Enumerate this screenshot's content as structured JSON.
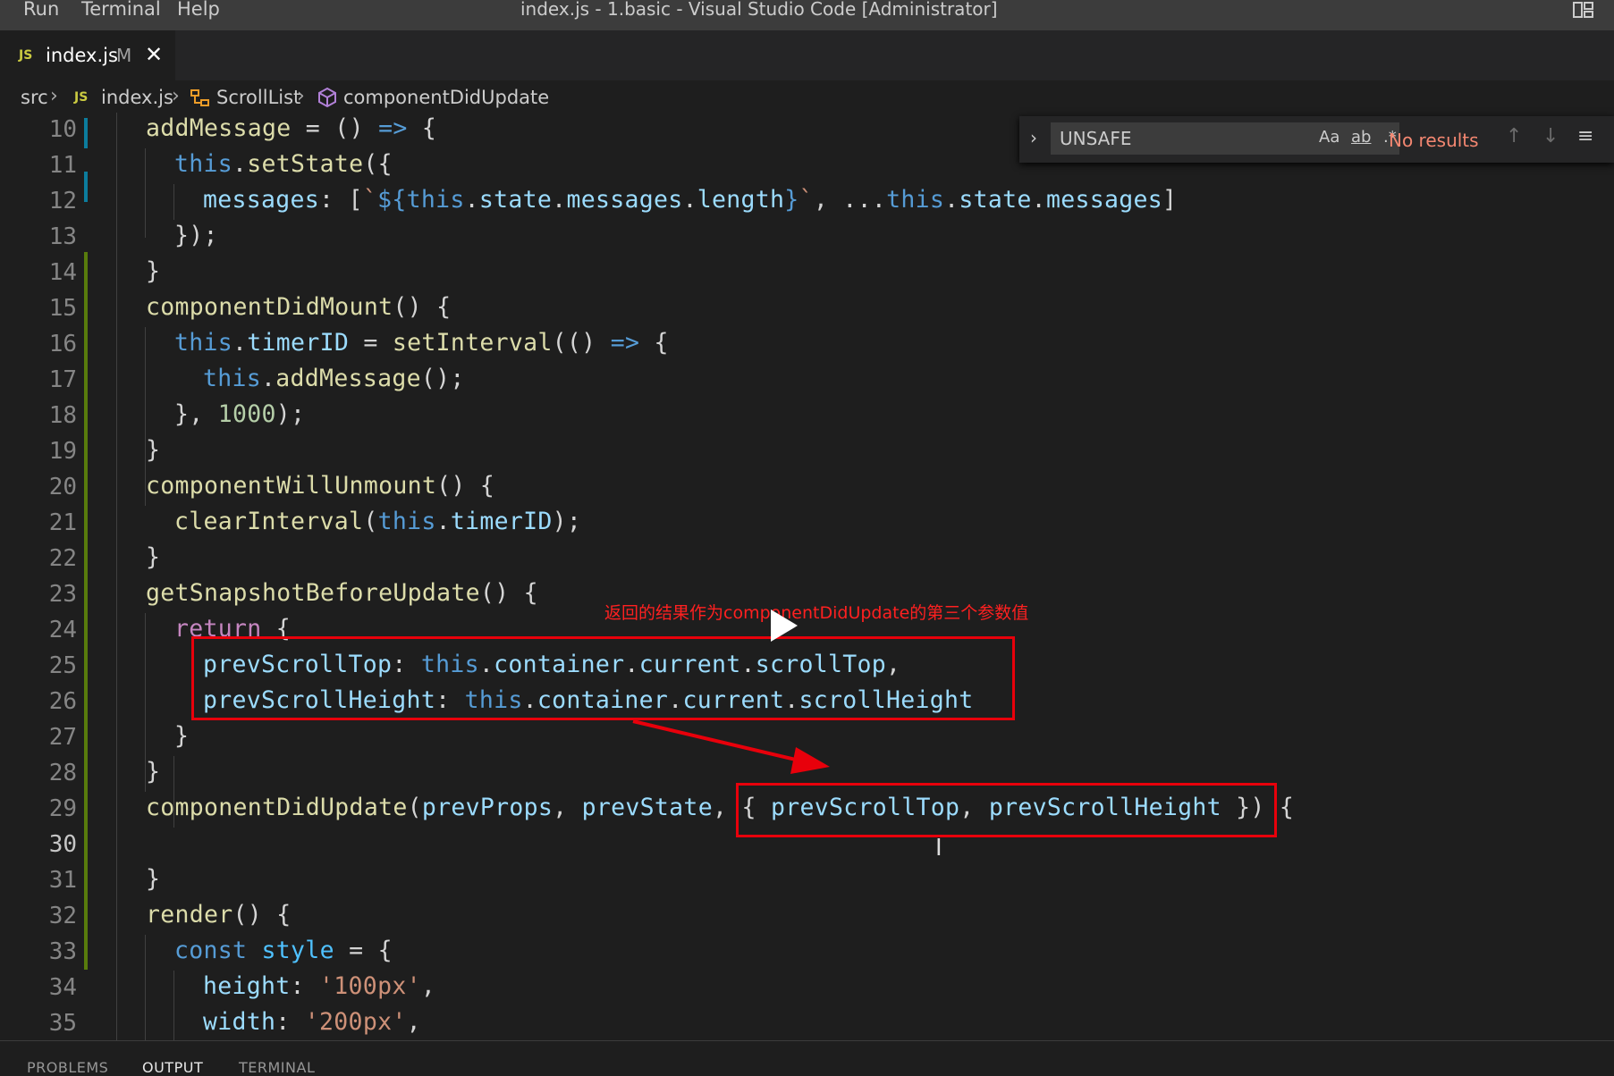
{
  "titlebar": {
    "menu": [
      "Run",
      "Terminal",
      "Help"
    ],
    "title": "index.js - 1.basic - Visual Studio Code [Administrator]"
  },
  "tab": {
    "icon": "JS",
    "name": "index.js",
    "modified": "M",
    "close": "✕"
  },
  "breadcrumb": {
    "folder": "src",
    "file_icon": "JS",
    "file": "index.js",
    "class": "ScrollList",
    "method": "componentDidUpdate"
  },
  "gutter": [
    "10",
    "11",
    "12",
    "13",
    "14",
    "15",
    "16",
    "17",
    "18",
    "19",
    "20",
    "21",
    "22",
    "23",
    "24",
    "25",
    "26",
    "27",
    "28",
    "29",
    "30",
    "31",
    "32",
    "33",
    "34",
    "35"
  ],
  "active_line": "30",
  "code": {
    "l10": [
      "addMessage",
      " = () ",
      "=>",
      " {"
    ],
    "l11": [
      "this",
      ".",
      "setState",
      "({"
    ],
    "l12": [
      "messages",
      ": [",
      "`",
      "${",
      "this",
      ".",
      "state",
      ".",
      "messages",
      ".",
      "length",
      "}",
      "`",
      ", ...",
      "this",
      ".",
      "state",
      ".",
      "messages",
      "]"
    ],
    "l13": [
      "});"
    ],
    "l14": [
      "}"
    ],
    "l15": [
      "componentDidMount",
      "() {"
    ],
    "l16": [
      "this",
      ".",
      "timerID",
      " = ",
      "setInterval",
      "(() ",
      "=>",
      " {"
    ],
    "l17": [
      "this",
      ".",
      "addMessage",
      "();"
    ],
    "l18": [
      "}, ",
      "1000",
      ");"
    ],
    "l19": [
      "}"
    ],
    "l20": [
      "componentWillUnmount",
      "() {"
    ],
    "l21": [
      "clearInterval",
      "(",
      "this",
      ".",
      "timerID",
      ");"
    ],
    "l22": [
      "}"
    ],
    "l23": [
      "getSnapshotBeforeUpdate",
      "() {"
    ],
    "l24": [
      "return",
      " {"
    ],
    "l25": [
      "prevScrollTop",
      ": ",
      "this",
      ".",
      "container",
      ".",
      "current",
      ".",
      "scrollTop",
      ","
    ],
    "l26": [
      "prevScrollHeight",
      ": ",
      "this",
      ".",
      "container",
      ".",
      "current",
      ".",
      "scrollHeight"
    ],
    "l27": [
      "}"
    ],
    "l28": [
      "}"
    ],
    "l29": [
      "componentDidUpdate",
      "(",
      "prevProps",
      ", ",
      "prevState",
      ", { ",
      "prevScrollTop",
      ", ",
      "prevScrollHeight",
      " }) {"
    ],
    "l30": [
      ""
    ],
    "l31": [
      "}"
    ],
    "l32": [
      "render",
      "() {"
    ],
    "l33": [
      "const",
      " ",
      "style",
      " = {"
    ],
    "l34": [
      "height",
      ": ",
      "'100px'",
      ","
    ],
    "l35": [
      "width",
      ": ",
      "'200px'",
      ","
    ]
  },
  "find": {
    "query": "UNSAFE",
    "match_case": "Aa",
    "whole_word": "ab",
    "regex": ".*",
    "result": "No results"
  },
  "annotation": "返回的结果作为componentDidUpdate的第三个参数值",
  "panel_tabs": [
    "PROBLEMS",
    "OUTPUT",
    "TERMINAL"
  ],
  "colors": {
    "annotation": "#e8000b",
    "git_added": "#587c0c",
    "git_modified": "#0c7d9d"
  }
}
